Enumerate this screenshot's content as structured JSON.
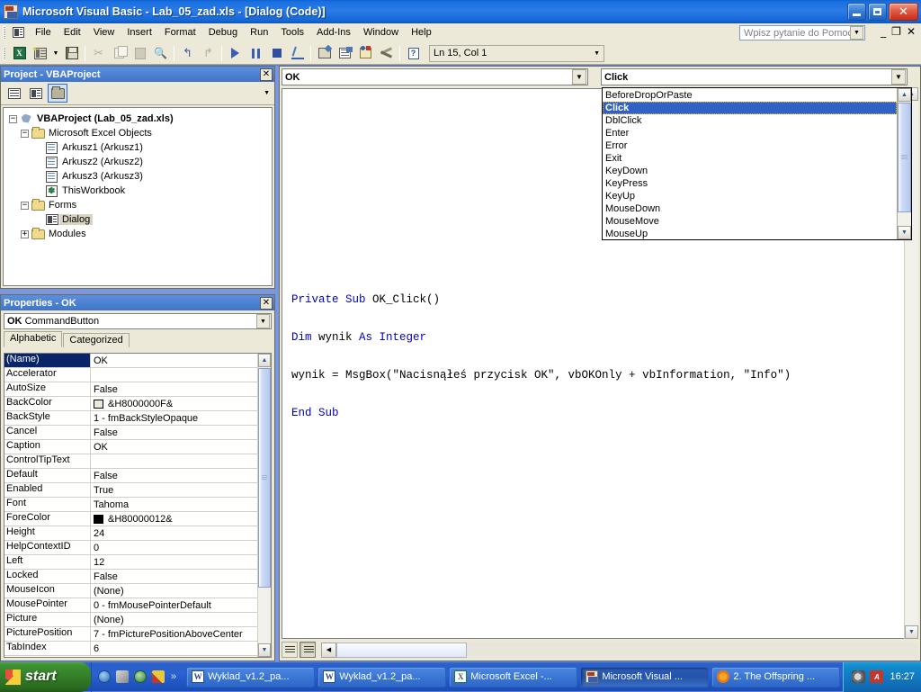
{
  "window": {
    "title": "Microsoft Visual Basic - Lab_05_zad.xls - [Dialog (Code)]",
    "icon": "vb-application-icon",
    "minimize": "minimize",
    "maximize": "restore",
    "close": "close"
  },
  "menubar": {
    "control_icon": "mdi-control-icon",
    "items": [
      {
        "label": "File",
        "accel": "F"
      },
      {
        "label": "Edit",
        "accel": "E"
      },
      {
        "label": "View",
        "accel": "V"
      },
      {
        "label": "Insert",
        "accel": "I"
      },
      {
        "label": "Format",
        "accel": "o"
      },
      {
        "label": "Debug",
        "accel": "D"
      },
      {
        "label": "Run",
        "accel": "R"
      },
      {
        "label": "Tools",
        "accel": "T"
      },
      {
        "label": "Add-Ins",
        "accel": "A"
      },
      {
        "label": "Window",
        "accel": "W"
      },
      {
        "label": "Help",
        "accel": "H"
      }
    ],
    "help_search": {
      "placeholder": "Wpisz pytanie do Pomocy",
      "value": ""
    },
    "mdi": {
      "minimize": "_",
      "restore": "❐",
      "close": "✕"
    }
  },
  "toolbar": {
    "buttons": [
      {
        "name": "view-excel-icon",
        "title": "View Microsoft Excel"
      },
      {
        "name": "insert-userform-icon",
        "title": "Insert UserForm"
      },
      {
        "name": "save-icon",
        "title": "Save Lab_05_zad.xls"
      },
      {
        "name": "cut-icon",
        "title": "Cut"
      },
      {
        "name": "copy-icon",
        "title": "Copy"
      },
      {
        "name": "paste-icon",
        "title": "Paste"
      },
      {
        "name": "find-icon",
        "title": "Find"
      },
      {
        "name": "undo-icon",
        "title": "Undo"
      },
      {
        "name": "redo-icon",
        "title": "Redo"
      },
      {
        "name": "run-icon",
        "title": "Run Sub/UserForm"
      },
      {
        "name": "break-icon",
        "title": "Break"
      },
      {
        "name": "reset-icon",
        "title": "Reset"
      },
      {
        "name": "design-mode-icon",
        "title": "Design Mode"
      },
      {
        "name": "project-explorer-icon",
        "title": "Project Explorer"
      },
      {
        "name": "properties-window-icon",
        "title": "Properties Window"
      },
      {
        "name": "object-browser-icon",
        "title": "Object Browser"
      },
      {
        "name": "toolbox-icon",
        "title": "Toolbox"
      },
      {
        "name": "help-icon",
        "title": "Microsoft Visual Basic Help"
      }
    ],
    "position_status": "Ln 15, Col 1"
  },
  "project_panel": {
    "title": "Project - VBAProject",
    "close_label": "✕",
    "toolbar": {
      "view_code": "View Code",
      "view_object": "View Object",
      "toggle_folders": "Toggle Folders"
    },
    "tree": [
      {
        "label": "VBAProject (Lab_05_zad.xls)",
        "icon": "vbproject-icon",
        "expander": "−",
        "depth": 0,
        "bold": true,
        "selected": false
      },
      {
        "label": "Microsoft Excel Objects",
        "icon": "folder-icon",
        "expander": "−",
        "depth": 1,
        "bold": false,
        "selected": false
      },
      {
        "label": "Arkusz1 (Arkusz1)",
        "icon": "worksheet-icon",
        "expander": "",
        "depth": 2,
        "bold": false,
        "selected": false
      },
      {
        "label": "Arkusz2 (Arkusz2)",
        "icon": "worksheet-icon",
        "expander": "",
        "depth": 2,
        "bold": false,
        "selected": false
      },
      {
        "label": "Arkusz3 (Arkusz3)",
        "icon": "worksheet-icon",
        "expander": "",
        "depth": 2,
        "bold": false,
        "selected": false
      },
      {
        "label": "ThisWorkbook",
        "icon": "workbook-icon",
        "expander": "",
        "depth": 2,
        "bold": false,
        "selected": false
      },
      {
        "label": "Forms",
        "icon": "folder-icon",
        "expander": "−",
        "depth": 1,
        "bold": false,
        "selected": false
      },
      {
        "label": "Dialog",
        "icon": "userform-icon",
        "expander": "",
        "depth": 2,
        "bold": false,
        "selected": true
      },
      {
        "label": "Modules",
        "icon": "folder-icon",
        "expander": "+",
        "depth": 1,
        "bold": false,
        "selected": false
      }
    ]
  },
  "properties_panel": {
    "title": "Properties - OK",
    "close_label": "✕",
    "object_selector": {
      "name": "OK",
      "type": "CommandButton"
    },
    "tabs": [
      {
        "label": "Alphabetic",
        "active": true
      },
      {
        "label": "Categorized",
        "active": false
      }
    ],
    "rows": [
      {
        "name": "(Name)",
        "value": "OK",
        "selected": true,
        "swatch": ""
      },
      {
        "name": "Accelerator",
        "value": "",
        "selected": false,
        "swatch": ""
      },
      {
        "name": "AutoSize",
        "value": "False",
        "selected": false,
        "swatch": ""
      },
      {
        "name": "BackColor",
        "value": "&H8000000F&",
        "selected": false,
        "swatch": "#ece9d8"
      },
      {
        "name": "BackStyle",
        "value": "1 - fmBackStyleOpaque",
        "selected": false,
        "swatch": ""
      },
      {
        "name": "Cancel",
        "value": "False",
        "selected": false,
        "swatch": ""
      },
      {
        "name": "Caption",
        "value": "OK",
        "selected": false,
        "swatch": ""
      },
      {
        "name": "ControlTipText",
        "value": "",
        "selected": false,
        "swatch": ""
      },
      {
        "name": "Default",
        "value": "False",
        "selected": false,
        "swatch": ""
      },
      {
        "name": "Enabled",
        "value": "True",
        "selected": false,
        "swatch": ""
      },
      {
        "name": "Font",
        "value": "Tahoma",
        "selected": false,
        "swatch": ""
      },
      {
        "name": "ForeColor",
        "value": "&H80000012&",
        "selected": false,
        "swatch": "#000000"
      },
      {
        "name": "Height",
        "value": "24",
        "selected": false,
        "swatch": ""
      },
      {
        "name": "HelpContextID",
        "value": "0",
        "selected": false,
        "swatch": ""
      },
      {
        "name": "Left",
        "value": "12",
        "selected": false,
        "swatch": ""
      },
      {
        "name": "Locked",
        "value": "False",
        "selected": false,
        "swatch": ""
      },
      {
        "name": "MouseIcon",
        "value": "(None)",
        "selected": false,
        "swatch": ""
      },
      {
        "name": "MousePointer",
        "value": "0 - fmMousePointerDefault",
        "selected": false,
        "swatch": ""
      },
      {
        "name": "Picture",
        "value": "(None)",
        "selected": false,
        "swatch": ""
      },
      {
        "name": "PicturePosition",
        "value": "7 - fmPicturePositionAboveCenter",
        "selected": false,
        "swatch": ""
      },
      {
        "name": "TabIndex",
        "value": "6",
        "selected": false,
        "swatch": ""
      }
    ]
  },
  "code_window": {
    "object_combo": {
      "value": "OK"
    },
    "procedure_combo": {
      "value": "Click"
    },
    "procedure_list": {
      "items": [
        "BeforeDropOrPaste",
        "Click",
        "DblClick",
        "Enter",
        "Error",
        "Exit",
        "KeyDown",
        "KeyPress",
        "KeyUp",
        "MouseDown",
        "MouseMove",
        "MouseUp"
      ],
      "selected": "Click"
    },
    "code": "Private Sub OK_Click()\n\nDim wynik As Integer\n\nwynik = MsgBox(\"Nacisnąłeś przycisk OK\", vbOKOnly + vbInformation, \"Info\")\n\nEnd Sub",
    "code_lines": [
      {
        "text": "Private Sub OK_Click()",
        "keywords": [
          "Private",
          "Sub"
        ]
      },
      {
        "text": "",
        "keywords": []
      },
      {
        "text": "Dim wynik As Integer",
        "keywords": [
          "Dim",
          "As",
          "Integer"
        ]
      },
      {
        "text": "",
        "keywords": []
      },
      {
        "text": "wynik = MsgBox(\"Nacisnąłeś przycisk OK\", vbOKOnly + vbInformation, \"Info\")",
        "keywords": []
      },
      {
        "text": "",
        "keywords": []
      },
      {
        "text": "End Sub",
        "keywords": [
          "End",
          "Sub"
        ]
      }
    ],
    "view_buttons": {
      "procedure_view": "Procedure View",
      "full_module_view": "Full Module View"
    }
  },
  "taskbar": {
    "start_label": "start",
    "quicklaunch": [
      {
        "name": "internet-explorer-icon"
      },
      {
        "name": "media-icon"
      },
      {
        "name": "globe-icon"
      },
      {
        "name": "paint-icon"
      }
    ],
    "quicklaunch_more": "»",
    "tasks": [
      {
        "label": "Wyklad_v1.2_pa...",
        "icon": "word-icon",
        "active": false
      },
      {
        "label": "Wyklad_v1.2_pa...",
        "icon": "word-icon",
        "active": false
      },
      {
        "label": "Microsoft Excel -...",
        "icon": "excel-icon",
        "active": false
      },
      {
        "label": "Microsoft Visual ...",
        "icon": "vb-icon",
        "active": true
      },
      {
        "label": "2. The Offspring ...",
        "icon": "media-player-icon",
        "active": false
      }
    ],
    "tray": [
      {
        "name": "volume-icon"
      },
      {
        "name": "ati-icon"
      }
    ],
    "clock": "16:27"
  }
}
